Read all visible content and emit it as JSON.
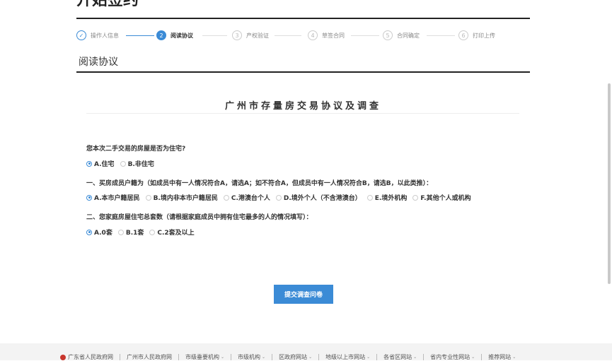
{
  "page": {
    "title": "开始签约"
  },
  "steps": [
    {
      "num": "✓",
      "label": "操作人信息",
      "state": "done"
    },
    {
      "num": "2",
      "label": "阅读协议",
      "state": "active"
    },
    {
      "num": "3",
      "label": "产权验证",
      "state": "todo"
    },
    {
      "num": "4",
      "label": "草签合同",
      "state": "todo"
    },
    {
      "num": "5",
      "label": "合同确定",
      "state": "todo"
    },
    {
      "num": "6",
      "label": "打印上传",
      "state": "todo"
    }
  ],
  "section": {
    "title": "阅读协议"
  },
  "document": {
    "title": "广州市存量房交易协议及调查"
  },
  "questions": [
    {
      "text": "您本次二手交易的房屋是否为住宅?",
      "options": [
        {
          "label": "A.住宅",
          "checked": true
        },
        {
          "label": "B.非住宅",
          "checked": false
        }
      ]
    },
    {
      "text": "一、买房成员户籍为（如成员中有一人情况符合A，请选A；如不符合A，但成员中有一人情况符合B，请选B，以此类推）：",
      "options": [
        {
          "label": "A.本市户籍居民",
          "checked": true
        },
        {
          "label": "B.境内非本市户籍居民",
          "checked": false
        },
        {
          "label": "C.港澳台个人",
          "checked": false
        },
        {
          "label": "D.境外个人（不含港澳台）",
          "checked": false
        },
        {
          "label": "E.境外机构",
          "checked": false
        },
        {
          "label": "F.其他个人或机构",
          "checked": false
        }
      ]
    },
    {
      "text": "二、您家庭房屋住宅总套数（请根据家庭成员中拥有住宅最多的人的情况填写）：",
      "options": [
        {
          "label": "A.0套",
          "checked": true
        },
        {
          "label": "B.1套",
          "checked": false
        },
        {
          "label": "C.2套及以上",
          "checked": false
        }
      ]
    }
  ],
  "submit": {
    "label": "提交调查问卷"
  },
  "footer": {
    "links": [
      {
        "label": "广东省人民政府网",
        "dropdown": false,
        "badge": true
      },
      {
        "label": "广州市人民政府网",
        "dropdown": false,
        "badge": false
      },
      {
        "label": "市级垂要机构",
        "dropdown": true,
        "badge": false
      },
      {
        "label": "市级机构",
        "dropdown": true,
        "badge": false
      },
      {
        "label": "区政府网站",
        "dropdown": true,
        "badge": false
      },
      {
        "label": "地级以上市网站",
        "dropdown": true,
        "badge": false
      },
      {
        "label": "各省区网站",
        "dropdown": true,
        "badge": false
      },
      {
        "label": "省内专业性网站",
        "dropdown": true,
        "badge": false
      },
      {
        "label": "推荐网站",
        "dropdown": true,
        "badge": false
      }
    ]
  },
  "colors": {
    "accent": "#3b8bd6",
    "footer_bg": "#f3f3f3"
  }
}
